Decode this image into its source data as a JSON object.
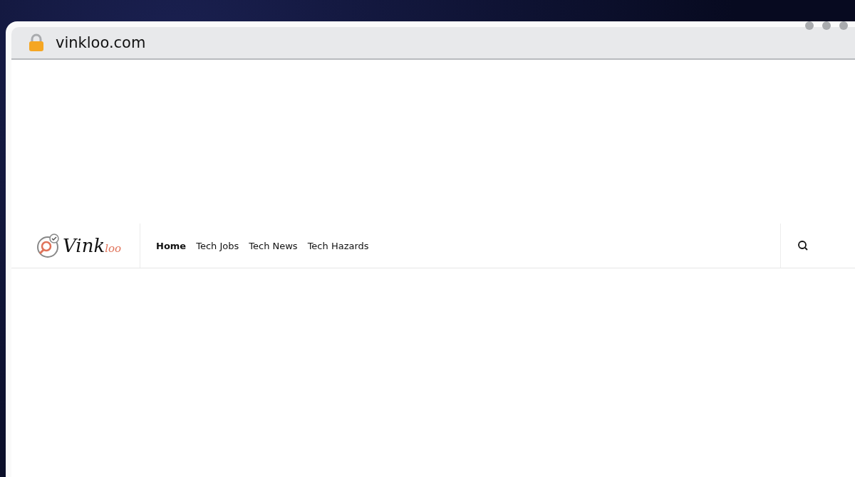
{
  "browser": {
    "url": "vinkloo.com"
  },
  "site_header": {
    "logo": {
      "main": "Vink",
      "accent": "loo"
    },
    "nav": [
      {
        "label": "Home",
        "selected": true
      },
      {
        "label": "Tech Jobs",
        "selected": false
      },
      {
        "label": "Tech News",
        "selected": false
      },
      {
        "label": "Tech Hazards",
        "selected": false
      }
    ]
  }
}
